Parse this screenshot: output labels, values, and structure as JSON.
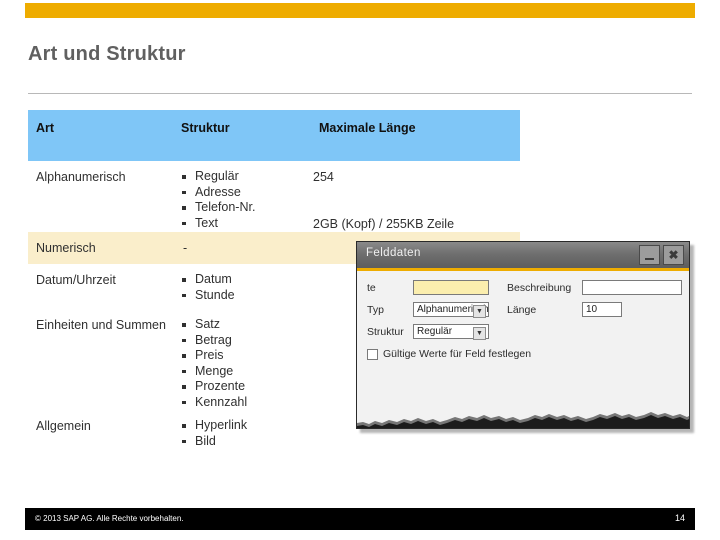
{
  "slide": {
    "title": "Art und Struktur",
    "accent_color": "#eeac00",
    "header_color": "#7fc6f7",
    "shade_color": "#faeecb"
  },
  "table": {
    "headers": {
      "art": "Art",
      "struktur": "Struktur",
      "laenge": "Maximale Länge"
    },
    "rows": [
      {
        "art": "Alphanumerisch",
        "struktur": [
          "Regulär",
          "Adresse",
          "Telefon-Nr.",
          "Text"
        ],
        "laenge_top": "254",
        "laenge_bottom": "2GB (Kopf) / 255KB Zeile"
      },
      {
        "art": "Numerisch",
        "struktur_dash": "-",
        "laenge": ""
      },
      {
        "art": "Datum/Uhrzeit",
        "struktur": [
          "Datum",
          "Stunde"
        ],
        "laenge": ""
      },
      {
        "art": "Einheiten und Summen",
        "struktur": [
          "Satz",
          "Betrag",
          "Preis",
          "Menge",
          "Prozente",
          "Kennzahl"
        ],
        "laenge": ""
      },
      {
        "art": "Allgemein",
        "struktur": [
          "Hyperlink",
          "Bild"
        ],
        "laenge": ""
      }
    ]
  },
  "dialog": {
    "title": "Felddaten",
    "minimize_label": "_",
    "close_label": "✖",
    "fields": {
      "name_label": "te",
      "name_value": "",
      "beschreibung_label": "Beschreibung",
      "beschreibung_value": "",
      "typ_label": "Typ",
      "typ_value": "Alphanumerisch",
      "laenge_label": "Länge",
      "laenge_value": "10",
      "struktur_label": "Struktur",
      "struktur_value": "Regulär",
      "checkbox_label": "Gültige Werte für Feld festlegen",
      "dropdown_arrow": "▼"
    }
  },
  "footer": {
    "copyright": "© 2013 SAP AG. Alle Rechte vorbehalten.",
    "page_number": "14"
  }
}
